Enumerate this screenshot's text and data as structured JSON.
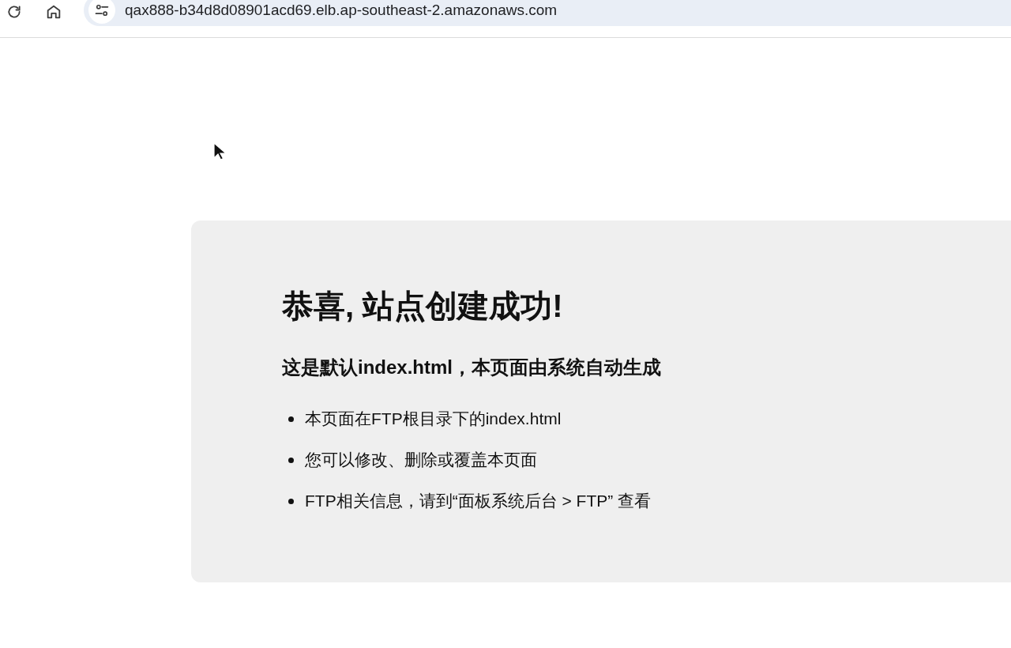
{
  "browser": {
    "url": "qax888-b34d8d08901acd69.elb.ap-southeast-2.amazonaws.com"
  },
  "page": {
    "title": "恭喜, 站点创建成功!",
    "subtitle": "这是默认index.html，本页面由系统自动生成",
    "items": [
      "本页面在FTP根目录下的index.html",
      "您可以修改、删除或覆盖本页面",
      "FTP相关信息，请到“面板系统后台 > FTP” 查看"
    ]
  }
}
